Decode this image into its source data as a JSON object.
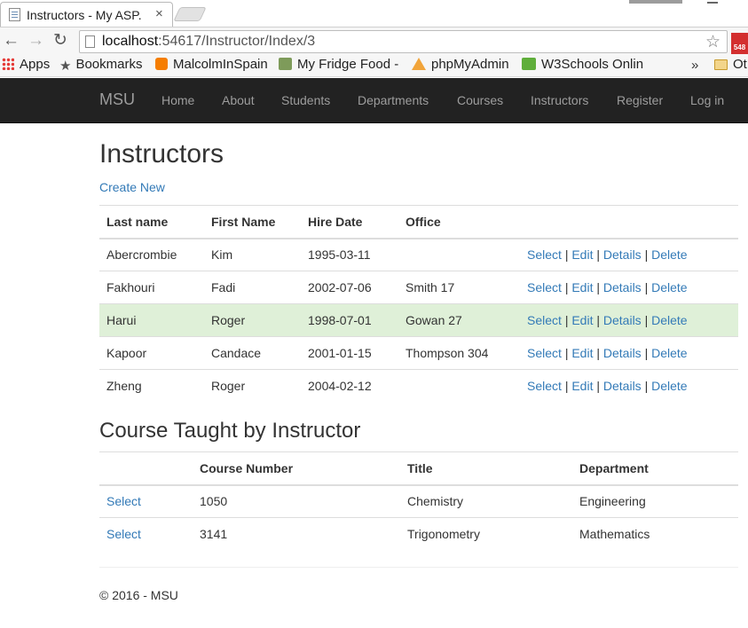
{
  "browser": {
    "tab_title": "Instructors - My ASP.",
    "tab_close": "×",
    "back": "←",
    "forward": "→",
    "reload": "↻",
    "url_host": "localhost",
    "url_rest": ":54617/Instructor/Index/3",
    "star": "☆",
    "ext_badge": "548"
  },
  "bookmarks": [
    {
      "label": "Apps",
      "icon": "apps-icon"
    },
    {
      "label": "Bookmarks",
      "icon": "star-icon"
    },
    {
      "label": "MalcolmInSpain",
      "icon": "blogger-icon"
    },
    {
      "label": "My Fridge Food -",
      "icon": "fridge-icon"
    },
    {
      "label": "phpMyAdmin",
      "icon": "phpmyadmin-icon"
    },
    {
      "label": "W3Schools Onlin",
      "icon": "w3schools-icon"
    }
  ],
  "bookmarks_more": "»",
  "bookmarks_other": "Ot",
  "navbar": {
    "brand": "MSU",
    "links": [
      "Home",
      "About",
      "Students",
      "Departments",
      "Courses",
      "Instructors",
      "Register",
      "Log in"
    ]
  },
  "page": {
    "title": "Instructors",
    "create_new": "Create New",
    "instructor_headers": [
      "Last name",
      "First Name",
      "Hire Date",
      "Office"
    ],
    "row_actions": [
      "Select",
      "Edit",
      "Details",
      "Delete"
    ],
    "action_separator": "|",
    "instructors": [
      {
        "last": "Abercrombie",
        "first": "Kim",
        "hire": "1995-03-11",
        "office": ""
      },
      {
        "last": "Fakhouri",
        "first": "Fadi",
        "hire": "2002-07-06",
        "office": "Smith 17"
      },
      {
        "last": "Harui",
        "first": "Roger",
        "hire": "1998-07-01",
        "office": "Gowan 27"
      },
      {
        "last": "Kapoor",
        "first": "Candace",
        "hire": "2001-01-15",
        "office": "Thompson 304"
      },
      {
        "last": "Zheng",
        "first": "Roger",
        "hire": "2004-02-12",
        "office": ""
      }
    ],
    "selected_instructor_index": 2,
    "courses_title": "Course Taught by Instructor",
    "course_headers": [
      "",
      "Course Number",
      "Title",
      "Department"
    ],
    "course_select_label": "Select",
    "courses": [
      {
        "number": "1050",
        "title": "Chemistry",
        "department": "Engineering"
      },
      {
        "number": "3141",
        "title": "Trigonometry",
        "department": "Mathematics"
      }
    ],
    "footer": "© 2016 - MSU"
  },
  "colors": {
    "navbar_bg": "#222222",
    "link": "#337ab7",
    "selected_row": "#dff0d8"
  }
}
